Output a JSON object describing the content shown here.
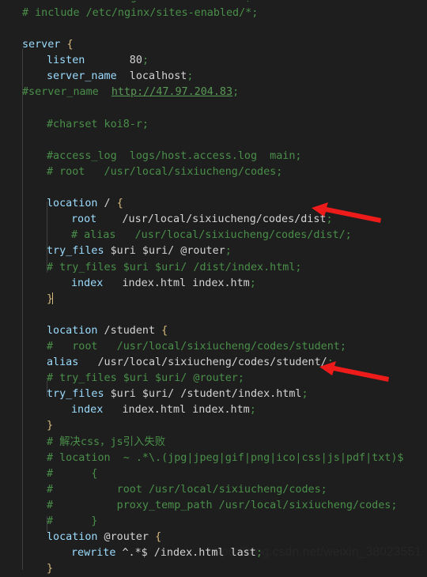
{
  "editor": {
    "language": "nginx-conf",
    "theme": "dark-plus",
    "background_color": "#1e1e1e",
    "foreground_color": "#d4d4d4",
    "comment_color": "#4a8f4a",
    "keyword_color": "#9cdcfe",
    "brace_color": "#d7ba7d",
    "indent_guide_color": "#404040",
    "arrow_color": "#ee1b1b"
  },
  "watermark": {
    "text": "https://blog.csdn.net/weixin_38023551"
  },
  "code": {
    "lines": [
      {
        "indent": 0,
        "clipped": true,
        "text": "#  include /etc/nginx/conf.d/*.conf;"
      },
      {
        "indent": 0,
        "text": "# include /etc/nginx/sites-enabled/*;"
      },
      {
        "indent": 0,
        "text": ""
      },
      {
        "indent": 0,
        "text": "server {"
      },
      {
        "indent": 1,
        "text": "    listen       80;"
      },
      {
        "indent": 1,
        "text": "    server_name  localhost;"
      },
      {
        "indent": 0,
        "text": "#server_name  http://47.97.204.83;"
      },
      {
        "indent": 1,
        "text": ""
      },
      {
        "indent": 1,
        "text": "    #charset koi8-r;"
      },
      {
        "indent": 1,
        "text": ""
      },
      {
        "indent": 1,
        "text": "    #access_log  logs/host.access.log  main;"
      },
      {
        "indent": 1,
        "text": "    # root   /usr/local/sixiucheng/codes;"
      },
      {
        "indent": 1,
        "text": ""
      },
      {
        "indent": 1,
        "text": "    location / {"
      },
      {
        "indent": 2,
        "text": "        root    /usr/local/sixiucheng/codes/dist;"
      },
      {
        "indent": 2,
        "text": "        # alias   /usr/local/sixiucheng/codes/dist/;"
      },
      {
        "indent": 1,
        "text": "    try_files $uri $uri/ @router;"
      },
      {
        "indent": 1,
        "text": "    # try_files $uri $uri/ /dist/index.html;"
      },
      {
        "indent": 2,
        "text": "        index   index.html index.htm;"
      },
      {
        "indent": 1,
        "text": "    }"
      },
      {
        "indent": 1,
        "text": ""
      },
      {
        "indent": 1,
        "text": "    location /student {"
      },
      {
        "indent": 1,
        "text": "    #   root   /usr/local/sixiucheng/codes/student;"
      },
      {
        "indent": 1,
        "text": "    alias   /usr/local/sixiucheng/codes/student/;"
      },
      {
        "indent": 1,
        "text": "    # try_files $uri $uri/ @router;"
      },
      {
        "indent": 1,
        "text": "    try_files $uri $uri/ /student/index.html;"
      },
      {
        "indent": 2,
        "text": "        index   index.html index.htm;"
      },
      {
        "indent": 1,
        "text": "    }"
      },
      {
        "indent": 1,
        "text": "    # 解决css，js引入失败"
      },
      {
        "indent": 1,
        "text": "    # location  ~ .*\\.(jpg|jpeg|gif|png|ico|css|js|pdf|txt)$"
      },
      {
        "indent": 1,
        "text": "    #      {"
      },
      {
        "indent": 1,
        "text": "    #          root /usr/local/sixiucheng/codes;"
      },
      {
        "indent": 1,
        "text": "    #          proxy_temp_path /usr/local/sixiucheng/codes;"
      },
      {
        "indent": 1,
        "text": "    #      }"
      },
      {
        "indent": 1,
        "text": "    location @router {"
      },
      {
        "indent": 2,
        "text": "        rewrite ^.*$ /index.html last;"
      },
      {
        "indent": 1,
        "text": "    }"
      }
    ],
    "annotations": [
      {
        "name": "arrow-root-dist",
        "points_at": "root    /usr/local/sixiucheng/codes/dist;"
      },
      {
        "name": "arrow-alias-student",
        "points_at": "alias   /usr/local/sixiucheng/codes/student/;"
      }
    ]
  }
}
